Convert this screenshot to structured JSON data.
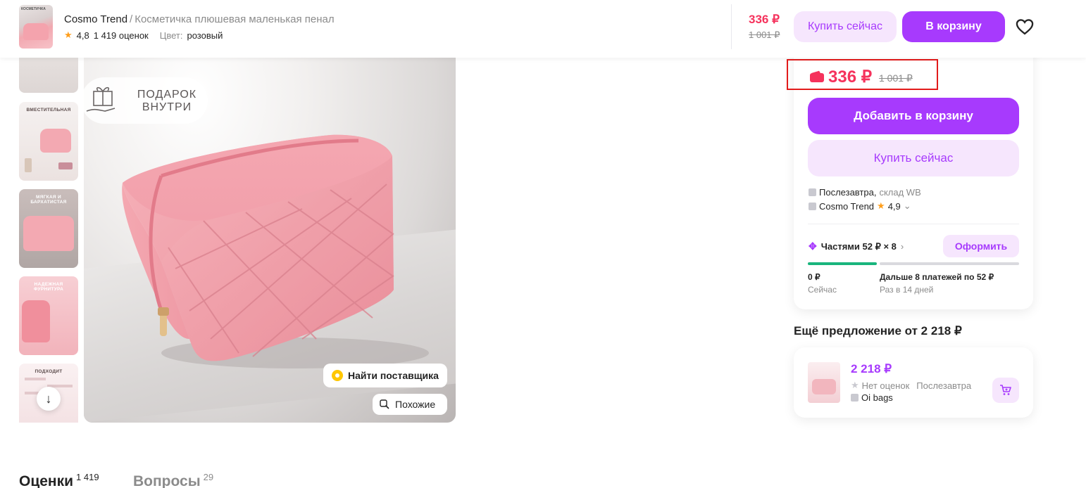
{
  "header": {
    "brand": "Cosmo Trend",
    "separator": "/",
    "product_name": "Косметичка плюшевая маленькая пенал",
    "rating": "4,8",
    "reviews": "1 419 оценок",
    "color_label": "Цвет:",
    "color_value": "розовый",
    "price_now": "336 ₽",
    "price_old": "1 001 ₽",
    "buy_now": "Купить сейчас",
    "to_cart": "В корзину",
    "thumb_label": "КОСМЕТИЧКА"
  },
  "gallery": {
    "thumbs": [
      "",
      "ВМЕСТИТЕЛЬНАЯ",
      "МЯГКАЯ И БАРХАТИСТАЯ",
      "НАДЕЖНАЯ ФУРНИТУРА",
      "ПОДХОДИТ"
    ],
    "gift_text": "ПОДАРОК ВНУТРИ",
    "find_supplier": "Найти поставщика",
    "similar": "Похожие"
  },
  "buybox": {
    "price": "336 ₽",
    "price_old": "1 001 ₽",
    "add_to_cart": "Добавить в корзину",
    "buy_now": "Купить сейчас",
    "delivery": "Послезавтра,",
    "warehouse": "склад WB",
    "seller": "Cosmo Trend",
    "seller_rating": "4,9",
    "installments": "Частями 52 ₽ × 8",
    "apply": "Оформить",
    "now_amount": "0 ₽",
    "now_label": "Сейчас",
    "later_amount": "Дальше 8 платежей по 52 ₽",
    "later_label": "Раз в 14 дней"
  },
  "another_offer": {
    "title": "Ещё предложение от 2 218 ₽",
    "price": "2 218 ₽",
    "no_ratings": "Нет оценок",
    "delivery": "Послезавтра",
    "seller": "Oi bags"
  },
  "tabs": [
    {
      "label": "Оценки",
      "count": "1 419"
    },
    {
      "label": "Вопросы",
      "count": "29"
    }
  ],
  "colors": {
    "accent": "#a73afd",
    "accent_light": "#f6e6fd",
    "price": "#f5325c",
    "highlight": "#e21b1b",
    "star": "#ff9e1b"
  }
}
